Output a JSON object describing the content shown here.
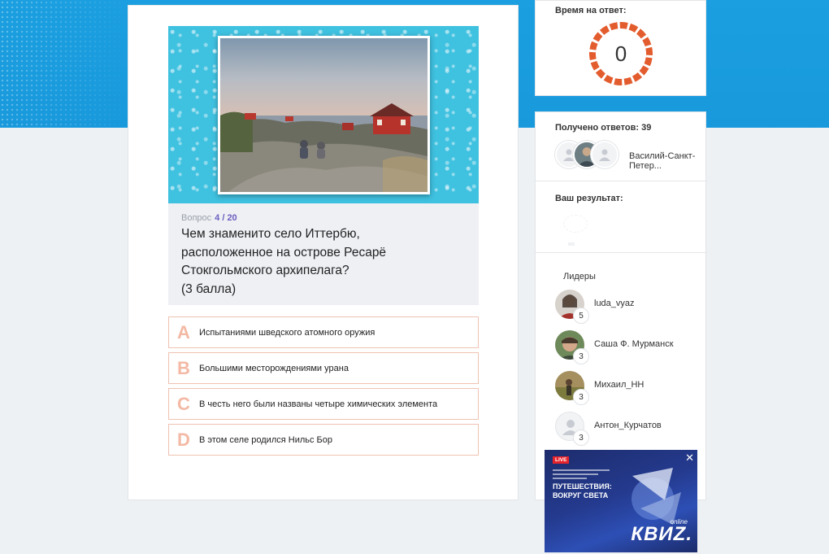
{
  "question": {
    "counter_label": "Вопрос",
    "counter_value": "4 / 20",
    "text_lines": [
      "Чем знаменито село Иттербю,",
      "расположенное на острове Ресарё",
      "Стокгольмского архипелага?",
      "(3 балла)"
    ]
  },
  "answers": [
    {
      "letter": "A",
      "text": "Испытаниями шведского атомного оружия"
    },
    {
      "letter": "B",
      "text": "Большими месторождениями урана"
    },
    {
      "letter": "C",
      "text": "В честь него были названы четыре химических элемента"
    },
    {
      "letter": "D",
      "text": "В этом селе родился Нильс Бор"
    }
  ],
  "timer": {
    "label": "Время на ответ:",
    "value": "0",
    "ring_color": "#e35c2e"
  },
  "responses": {
    "label": "Получено ответов: 39",
    "last_user": "Василий-Санкт-Петер..."
  },
  "result": {
    "label": "Ваш результат:"
  },
  "leaders": {
    "label": "Лидеры",
    "items": [
      {
        "name": "luda_vyaz",
        "score": "5"
      },
      {
        "name": "Саша Ф. Мурманск",
        "score": "3"
      },
      {
        "name": "Михаил_НН",
        "score": "3"
      },
      {
        "name": "Антон_Курчатов",
        "score": "3"
      }
    ]
  },
  "ad": {
    "live_badge": "LIVE",
    "headline": "ПУТЕШЕСТВИЯ: ВОКРУГ СВЕТА",
    "online": "online",
    "brand": "КВИZ.",
    "close": "✕"
  },
  "colors": {
    "accent": "#6b5fc0",
    "answer_border": "#efc3b2",
    "answer_letter": "#f3b9a4",
    "header_bg": "#1b9fe0"
  }
}
